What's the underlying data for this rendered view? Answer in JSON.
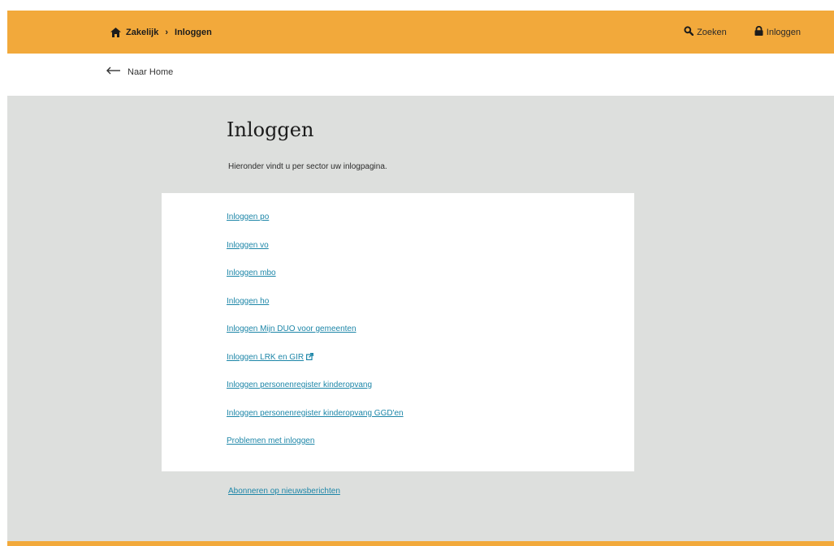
{
  "header": {
    "breadcrumb": {
      "home_icon": "home-icon",
      "section": "Zakelijk",
      "separator": "›",
      "current": "Inloggen"
    },
    "search_label": "Zoeken",
    "search_icon": "search-icon",
    "login_label": "Inloggen",
    "login_icon": "lock-icon"
  },
  "back_link": {
    "label": "Naar Home",
    "icon": "arrow-left-icon"
  },
  "main": {
    "title": "Inloggen",
    "intro": "Hieronder vindt u per sector uw inlogpagina.",
    "links": [
      "Inloggen po",
      "Inloggen vo",
      "Inloggen mbo",
      "Inloggen ho",
      "Inloggen Mijn DUO voor gemeenten",
      "Inloggen LRK en GIR",
      "Inloggen personenregister kinderopvang",
      "Inloggen personenregister kinderopvang GGD'en",
      "Problemen met inloggen"
    ],
    "external_icon": "external-link-icon",
    "footer_link": "Abonneren op nieuwsberichten"
  },
  "colors": {
    "header_bg": "#f2a93b",
    "main_bg": "#dddfdd",
    "link": "#1d86a8"
  }
}
